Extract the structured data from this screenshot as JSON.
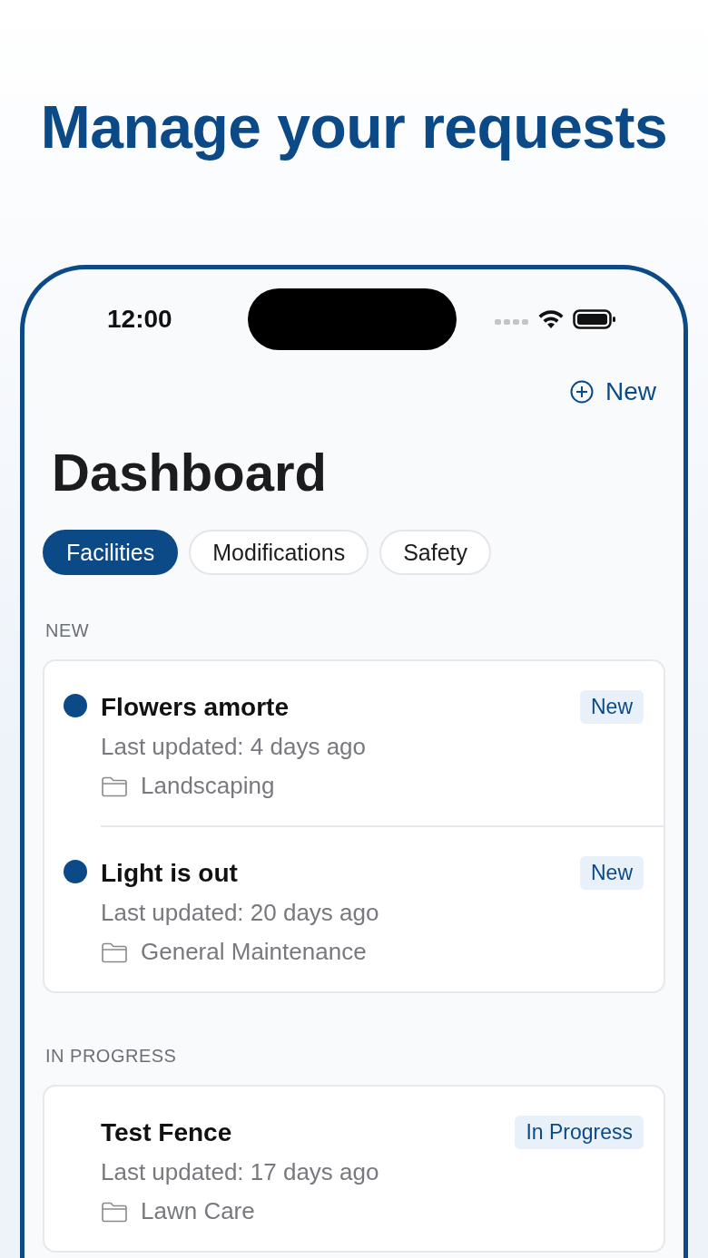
{
  "headline": "Manage your requests",
  "status_bar": {
    "time": "12:00"
  },
  "new_button": {
    "label": "New"
  },
  "title": "Dashboard",
  "filters": [
    {
      "label": "Facilities",
      "selected": true
    },
    {
      "label": "Modifications",
      "selected": false
    },
    {
      "label": "Safety",
      "selected": false
    }
  ],
  "sections": [
    {
      "heading": "NEW",
      "requests": [
        {
          "title": "Flowers amorte",
          "unread": true,
          "status": "New",
          "updated": "Last updated: 4 days ago",
          "category": "Landscaping"
        },
        {
          "title": "Light is out",
          "unread": true,
          "status": "New",
          "updated": "Last updated: 20 days ago",
          "category": "General Maintenance"
        }
      ]
    },
    {
      "heading": "IN PROGRESS",
      "requests": [
        {
          "title": "Test Fence",
          "unread": false,
          "status": "In Progress",
          "updated": "Last updated: 17 days ago",
          "category": "Lawn Care"
        }
      ]
    }
  ]
}
